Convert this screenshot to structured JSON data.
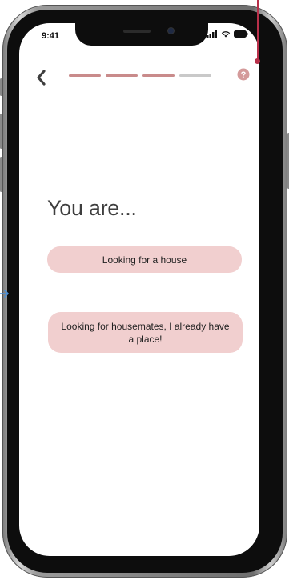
{
  "status_bar": {
    "time": "9:41"
  },
  "header": {
    "back_icon": "chevron-left-icon",
    "help_icon": "question-circle-icon",
    "progress": {
      "total_steps": 4,
      "completed_steps": 3
    }
  },
  "main": {
    "heading": "You are...",
    "options": [
      {
        "label": "Looking for a house"
      },
      {
        "label": "Looking for housemates, I already have a place!"
      }
    ]
  },
  "colors": {
    "accent": "#c98b8b",
    "option_bg": "#f1cfcf",
    "progress_inactive": "#c9c9c9",
    "help_icon": "#d49a9a",
    "annotation_red": "#b8304a",
    "annotation_blue": "#4a90d9"
  }
}
